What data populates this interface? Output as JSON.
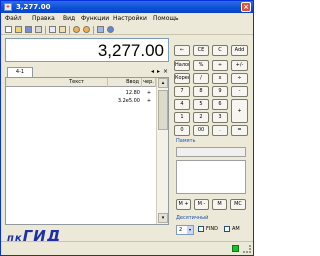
{
  "window": {
    "title": "3,277.00",
    "close_glyph": "×"
  },
  "menu": {
    "items": [
      "Файл",
      "Правка",
      "Вид",
      "Функции",
      "Настройки",
      "Помощь"
    ]
  },
  "toolbar": {
    "icons": [
      "new-icon",
      "open-icon",
      "save-icon",
      "print-icon",
      "copy-icon",
      "paste-icon",
      "undo-icon",
      "redo-icon",
      "calc-icon",
      "help-icon"
    ]
  },
  "display": {
    "value": "3,277.00"
  },
  "tabs": {
    "active": "4-1",
    "nav_left": "◂",
    "nav_right": "▸",
    "nav_close": "×"
  },
  "tape": {
    "columns": [
      "Текст",
      "Ввод",
      "чер."
    ],
    "rows": [
      {
        "text": "",
        "input": "12.80",
        "op": "+"
      },
      {
        "text": "",
        "input": "3.2e5.00",
        "op": "+"
      }
    ]
  },
  "keypad": {
    "row1": [
      "←",
      "CE",
      "C",
      "Add"
    ],
    "row2": [
      "Налог",
      "%",
      "÷",
      "+/-"
    ],
    "row3": [
      "Корень",
      "/",
      "x",
      "÷"
    ],
    "row4": [
      "7",
      "8",
      "9",
      "-"
    ],
    "row5": [
      "4",
      "5",
      "6",
      "+"
    ],
    "row6": [
      "1",
      "2",
      "3",
      "="
    ],
    "row7": [
      "0",
      "00",
      "."
    ]
  },
  "memory": {
    "label": "Память",
    "buttons": [
      "M +",
      "M -",
      "M",
      "MC"
    ]
  },
  "decimal": {
    "label": "Десятичный",
    "value": "2",
    "arrow": "▾",
    "find_label": "FIND",
    "am_label": "AM"
  },
  "brand": {
    "prefix": "пк",
    "name": "ГИД"
  },
  "colors": {
    "title_bar": "#0b4fd6",
    "status_light": "#19c02a",
    "brand": "#1e2fa8"
  }
}
